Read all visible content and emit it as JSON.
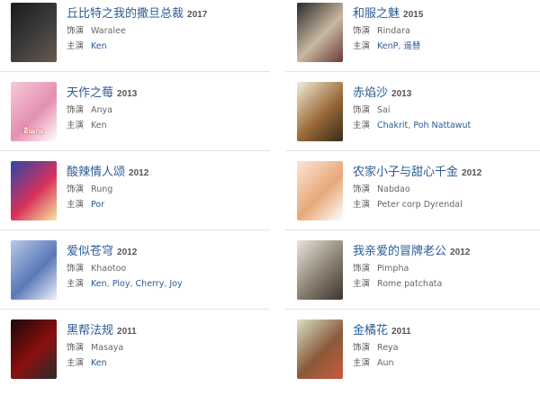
{
  "labels": {
    "role": "饰演",
    "star": "主演"
  },
  "left": [
    {
      "title": "丘比特之我的撒旦总裁",
      "year": "2017",
      "role": "Waralee",
      "stars": [
        {
          "name": "Ken",
          "link": true
        }
      ],
      "poster_colors": [
        "#1a1a1a",
        "#3d3d3d",
        "#6b5a4a"
      ]
    },
    {
      "title": "天作之莓",
      "year": "2013",
      "role": "Anya",
      "stars": [
        {
          "name": "Ken",
          "link": false
        }
      ],
      "poster_colors": [
        "#f6c9d8",
        "#e48fb0",
        "#ffffff"
      ],
      "poster_text": "อินเกะ"
    },
    {
      "title": "酸辣情人颂",
      "year": "2012",
      "role": "Rung",
      "stars": [
        {
          "name": "Por",
          "link": true
        }
      ],
      "poster_colors": [
        "#2a46a8",
        "#d8315b",
        "#f4e8a0"
      ]
    },
    {
      "title": "爱似苍穹",
      "year": "2012",
      "role": "Khaotoo",
      "stars": [
        {
          "name": "Ken",
          "link": true
        },
        {
          "name": "Ploy",
          "link": true
        },
        {
          "name": "Cherry",
          "link": true
        },
        {
          "name": "Joy",
          "link": true
        }
      ],
      "poster_colors": [
        "#b8c8e8",
        "#5a78b8",
        "#eef2fb"
      ]
    },
    {
      "title": "黑帮法规",
      "year": "2011",
      "role": "Masaya",
      "stars": [
        {
          "name": "Ken",
          "link": true
        }
      ],
      "poster_colors": [
        "#1a0808",
        "#8a1010",
        "#2a2a2a"
      ]
    }
  ],
  "right": [
    {
      "title": "和服之魅",
      "year": "2015",
      "role": "Rindara",
      "stars": [
        {
          "name": "KenP",
          "link": true
        },
        {
          "name": "遥替",
          "link": true
        }
      ],
      "poster_colors": [
        "#2a2a2a",
        "#c9b8a0",
        "#6a3a3a"
      ]
    },
    {
      "title": "赤焰沙",
      "year": "2013",
      "role": "Sai",
      "stars": [
        {
          "name": "Chakrit",
          "link": true
        },
        {
          "name": "Poh Nattawut",
          "link": true
        }
      ],
      "poster_colors": [
        "#f2ecd8",
        "#9a6a3a",
        "#3a2a1a"
      ]
    },
    {
      "title": "农家小子与甜心千金",
      "year": "2012",
      "role": "Nabdao",
      "stars": [
        {
          "name": "Peter corp Dyrendal",
          "link": false
        }
      ],
      "poster_colors": [
        "#fbe6d6",
        "#e8a878",
        "#ffffff"
      ]
    },
    {
      "title": "我亲爱的冒牌老公",
      "year": "2012",
      "role": "Pimpha",
      "stars": [
        {
          "name": "Rome patchata",
          "link": false
        }
      ],
      "poster_colors": [
        "#e8e4dc",
        "#8a8070",
        "#3a3530"
      ]
    },
    {
      "title": "金橘花",
      "year": "2011",
      "role": "Reya",
      "stars": [
        {
          "name": "Aun",
          "link": false
        }
      ],
      "poster_colors": [
        "#d8e0c8",
        "#8a5a3a",
        "#c85a3a"
      ]
    }
  ]
}
